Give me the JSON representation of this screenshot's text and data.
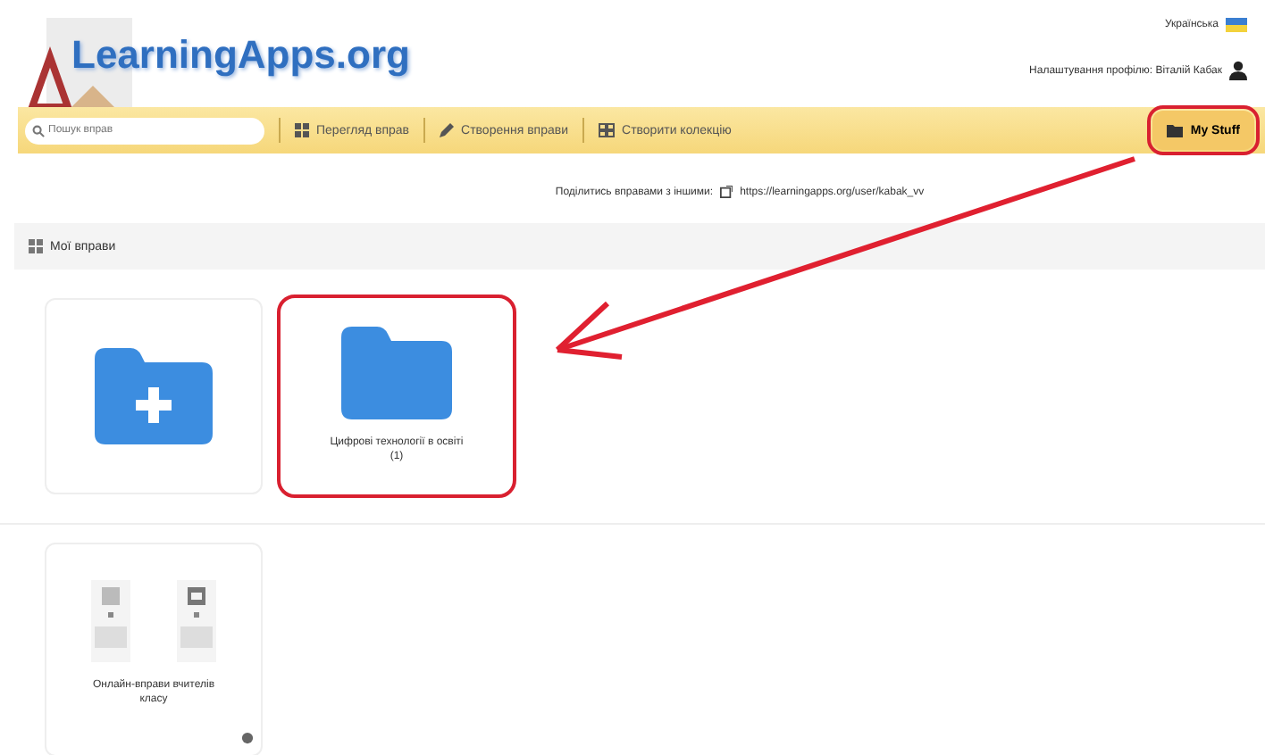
{
  "language": {
    "label": "Українська"
  },
  "logo": {
    "text": "LearningApps.org"
  },
  "profile": {
    "label": "Налаштування профілю: Віталій Кабак"
  },
  "toolbar": {
    "search": {
      "placeholder": "Пошук вправ"
    },
    "items": [
      {
        "label": "Перегляд вправ",
        "kind": "grid"
      },
      {
        "label": "Створення вправи",
        "kind": "pencil"
      },
      {
        "label": "Створити колекцію",
        "kind": "collection"
      }
    ],
    "my_stuff": {
      "label": "My Stuff",
      "highlighted": true
    }
  },
  "share": {
    "text": "Поділитись вправами з іншими:",
    "link": "https://learningapps.org/user/kabak_vv"
  },
  "section": {
    "title": "Мої вправи"
  },
  "folders": [
    {
      "kind": "new"
    },
    {
      "kind": "folder",
      "label": "Цифрові технології в освіті (1)",
      "highlighted": true
    }
  ],
  "templates": [
    {
      "label": "Онлайн-вправи вчителів класу"
    }
  ]
}
